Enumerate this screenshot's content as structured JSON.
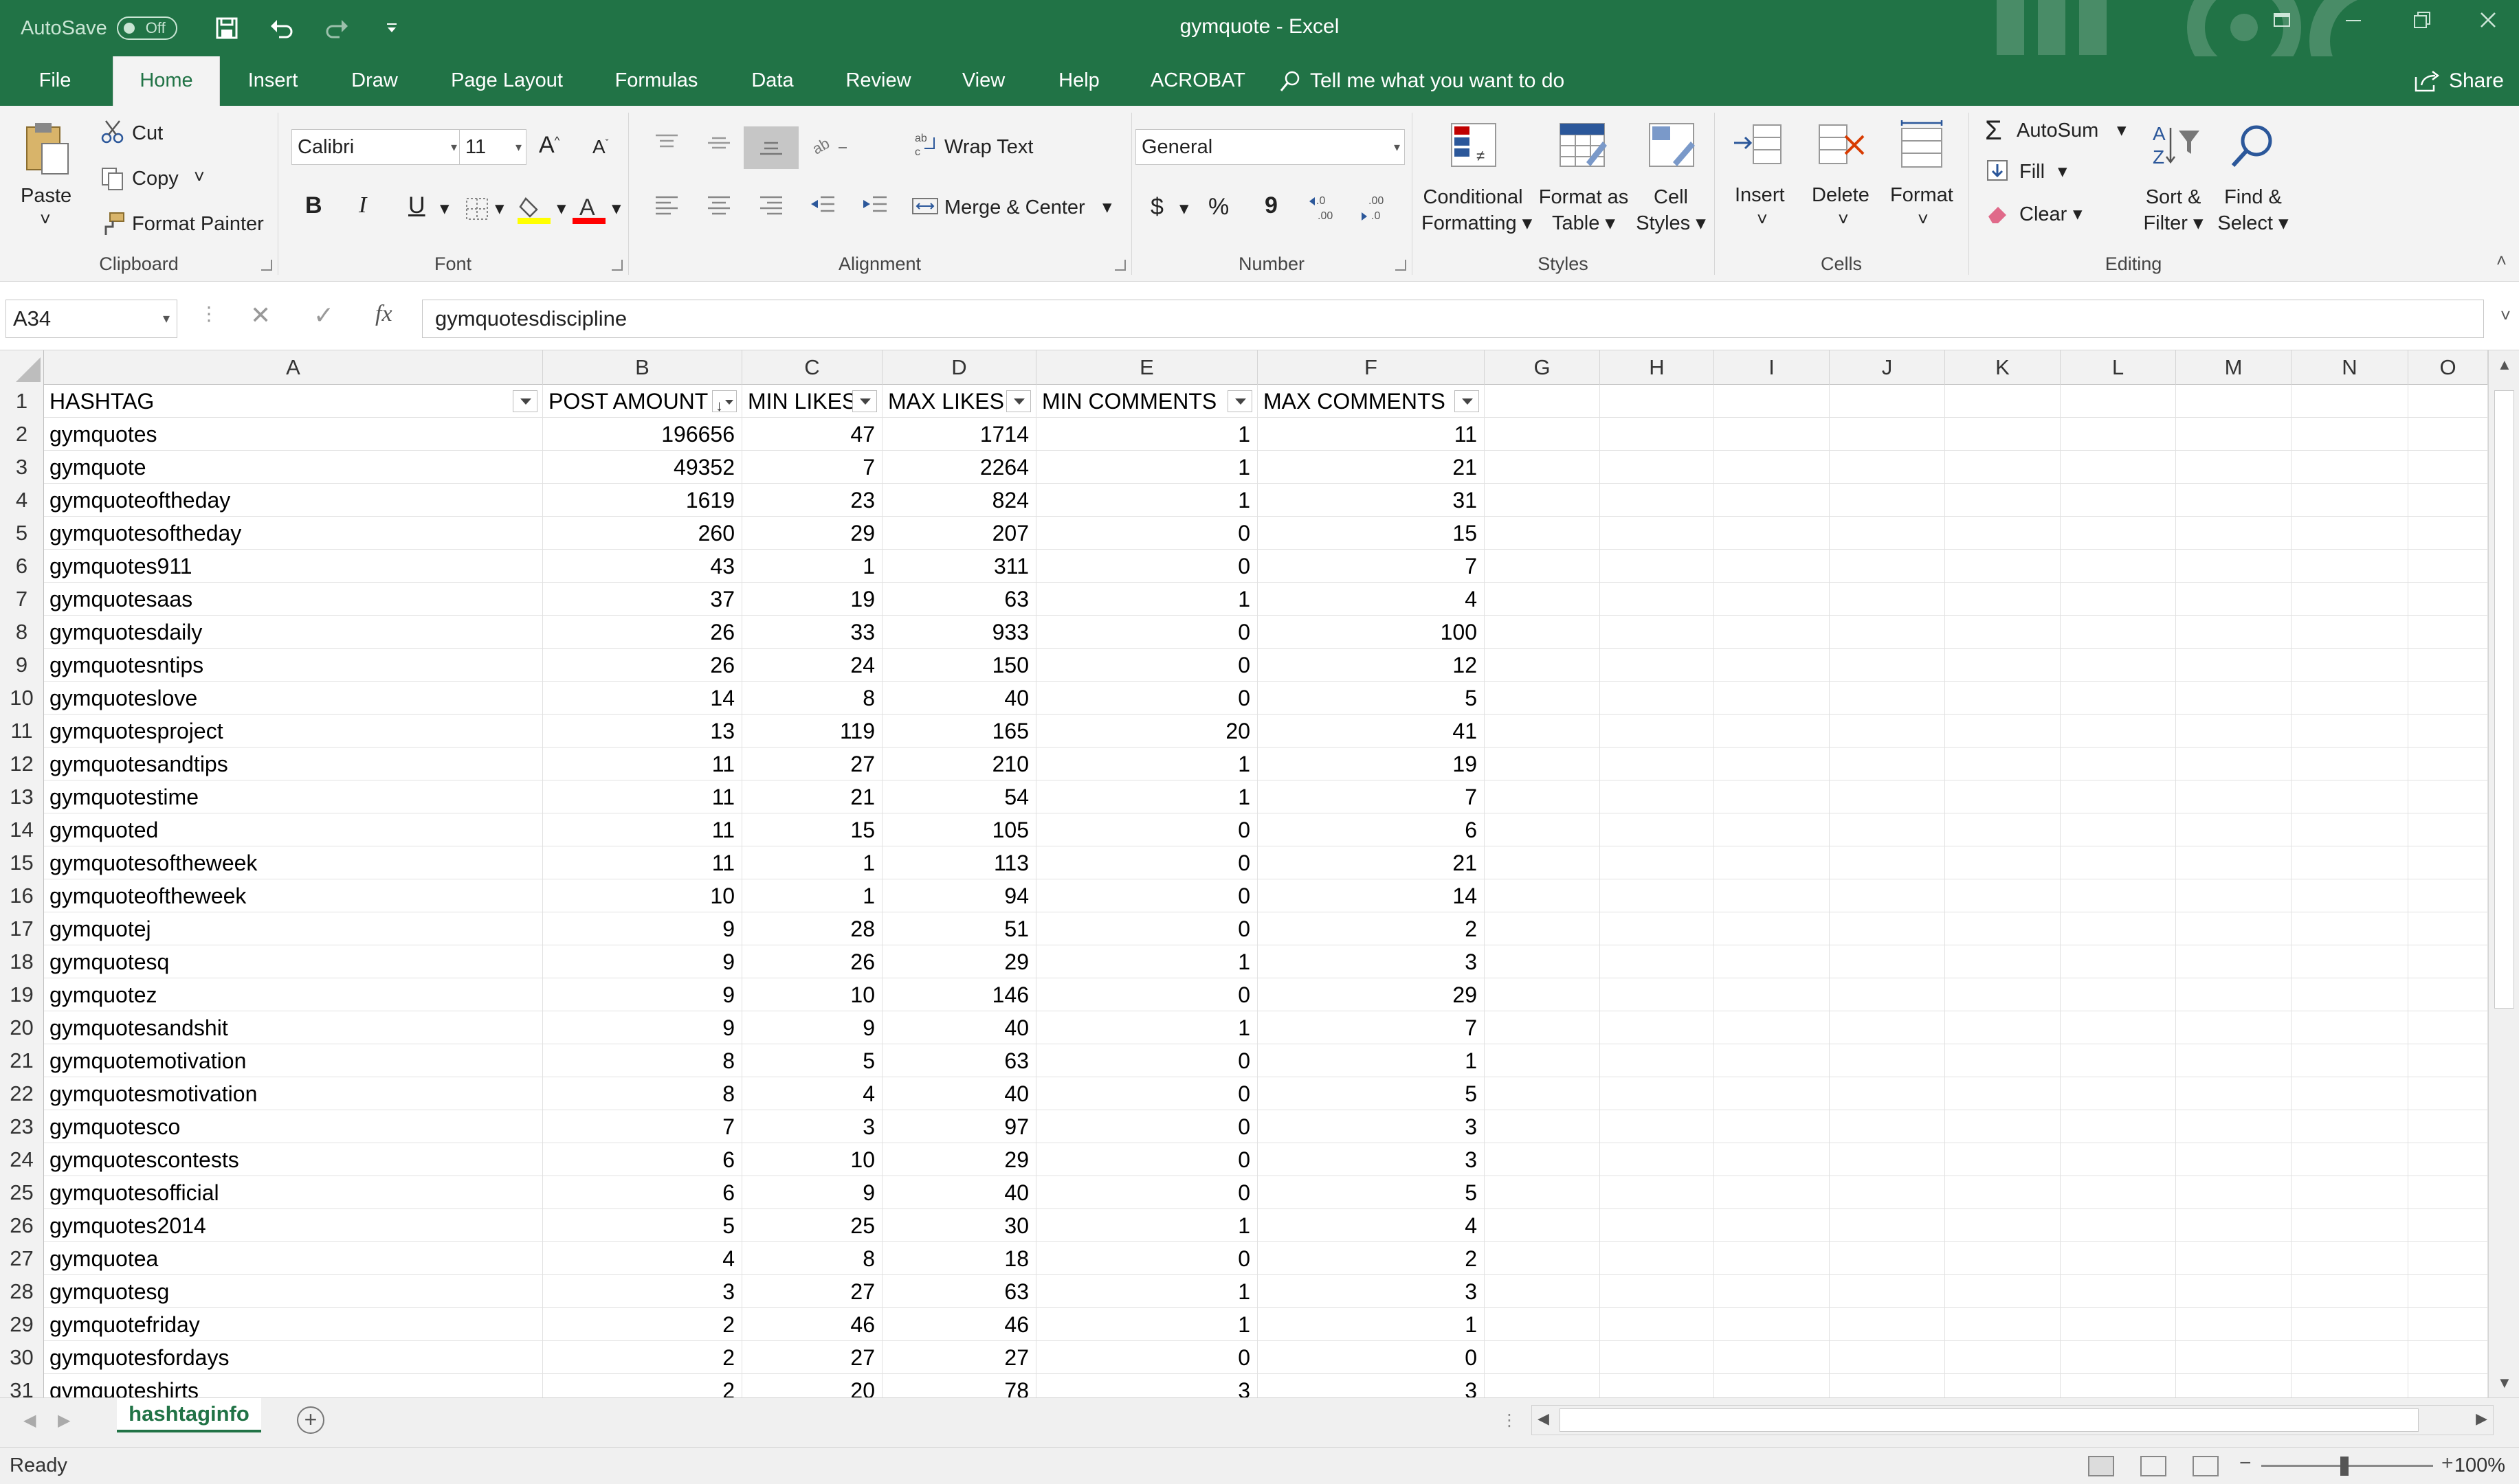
{
  "titlebar": {
    "autosave_label": "AutoSave",
    "autosave_state": "Off",
    "document_title": "gymquote  -  Excel"
  },
  "tabs": [
    "File",
    "Home",
    "Insert",
    "Draw",
    "Page Layout",
    "Formulas",
    "Data",
    "Review",
    "View",
    "Help",
    "ACROBAT"
  ],
  "active_tab": "Home",
  "tell_me": "Tell me what you want to do",
  "share_label": "Share",
  "ribbon": {
    "clipboard": {
      "paste": "Paste",
      "cut": "Cut",
      "copy": "Copy",
      "format_painter": "Format Painter",
      "label": "Clipboard"
    },
    "font": {
      "name": "Calibri",
      "size": "11",
      "label": "Font"
    },
    "alignment": {
      "wrap_text": "Wrap Text",
      "merge_center": "Merge & Center",
      "label": "Alignment"
    },
    "number": {
      "format": "General",
      "label": "Number",
      "currency": "$",
      "percent": "%",
      "comma": "9"
    },
    "styles": {
      "conditional_1": "Conditional",
      "conditional_2": "Formatting",
      "format_table_1": "Format as",
      "format_table_2": "Table",
      "cell_styles_1": "Cell",
      "cell_styles_2": "Styles",
      "label": "Styles"
    },
    "cells": {
      "insert": "Insert",
      "delete": "Delete",
      "format": "Format",
      "label": "Cells"
    },
    "editing": {
      "autosum": "AutoSum",
      "fill": "Fill",
      "clear": "Clear",
      "sort_1": "Sort &",
      "sort_2": "Filter",
      "find_1": "Find &",
      "find_2": "Select",
      "label": "Editing"
    }
  },
  "formula_bar": {
    "name_box": "A34",
    "fx": "fx",
    "formula": "gymquotesdiscipline"
  },
  "columns": [
    "A",
    "B",
    "C",
    "D",
    "E",
    "F",
    "G",
    "H",
    "I",
    "J",
    "K",
    "L",
    "M",
    "N",
    "O"
  ],
  "headers": [
    "HASHTAG",
    "POST AMOUNT",
    "MIN LIKES",
    "MAX LIKES",
    "MIN COMMENTS",
    "MAX COMMENTS"
  ],
  "rows": [
    [
      "gymquotes",
      "196656",
      "47",
      "1714",
      "1",
      "11"
    ],
    [
      "gymquote",
      "49352",
      "7",
      "2264",
      "1",
      "21"
    ],
    [
      "gymquoteoftheday",
      "1619",
      "23",
      "824",
      "1",
      "31"
    ],
    [
      "gymquotesoftheday",
      "260",
      "29",
      "207",
      "0",
      "15"
    ],
    [
      "gymquotes911",
      "43",
      "1",
      "311",
      "0",
      "7"
    ],
    [
      "gymquotesaas",
      "37",
      "19",
      "63",
      "1",
      "4"
    ],
    [
      "gymquotesdaily",
      "26",
      "33",
      "933",
      "0",
      "100"
    ],
    [
      "gymquotesntips",
      "26",
      "24",
      "150",
      "0",
      "12"
    ],
    [
      "gymquoteslove",
      "14",
      "8",
      "40",
      "0",
      "5"
    ],
    [
      "gymquotesproject",
      "13",
      "119",
      "165",
      "20",
      "41"
    ],
    [
      "gymquotesandtips",
      "11",
      "27",
      "210",
      "1",
      "19"
    ],
    [
      "gymquotestime",
      "11",
      "21",
      "54",
      "1",
      "7"
    ],
    [
      "gymquoted",
      "11",
      "15",
      "105",
      "0",
      "6"
    ],
    [
      "gymquotesoftheweek",
      "11",
      "1",
      "113",
      "0",
      "21"
    ],
    [
      "gymquoteoftheweek",
      "10",
      "1",
      "94",
      "0",
      "14"
    ],
    [
      "gymquotej",
      "9",
      "28",
      "51",
      "0",
      "2"
    ],
    [
      "gymquotesq",
      "9",
      "26",
      "29",
      "1",
      "3"
    ],
    [
      "gymquotez",
      "9",
      "10",
      "146",
      "0",
      "29"
    ],
    [
      "gymquotesandshit",
      "9",
      "9",
      "40",
      "1",
      "7"
    ],
    [
      "gymquotemotivation",
      "8",
      "5",
      "63",
      "0",
      "1"
    ],
    [
      "gymquotesmotivation",
      "8",
      "4",
      "40",
      "0",
      "5"
    ],
    [
      "gymquotesco",
      "7",
      "3",
      "97",
      "0",
      "3"
    ],
    [
      "gymquotescontests",
      "6",
      "10",
      "29",
      "0",
      "3"
    ],
    [
      "gymquotesofficial",
      "6",
      "9",
      "40",
      "0",
      "5"
    ],
    [
      "gymquotes2014",
      "5",
      "25",
      "30",
      "1",
      "4"
    ],
    [
      "gymquotea",
      "4",
      "8",
      "18",
      "0",
      "2"
    ],
    [
      "gymquotesg",
      "3",
      "27",
      "63",
      "1",
      "3"
    ],
    [
      "gymquotefriday",
      "2",
      "46",
      "46",
      "1",
      "1"
    ],
    [
      "gymquotesfordays",
      "2",
      "27",
      "27",
      "0",
      "0"
    ],
    [
      "gymquoteshirts",
      "2",
      "20",
      "78",
      "3",
      "3"
    ]
  ],
  "sheet_tab": "hashtaginfo",
  "status": "Ready",
  "zoom": "100%"
}
